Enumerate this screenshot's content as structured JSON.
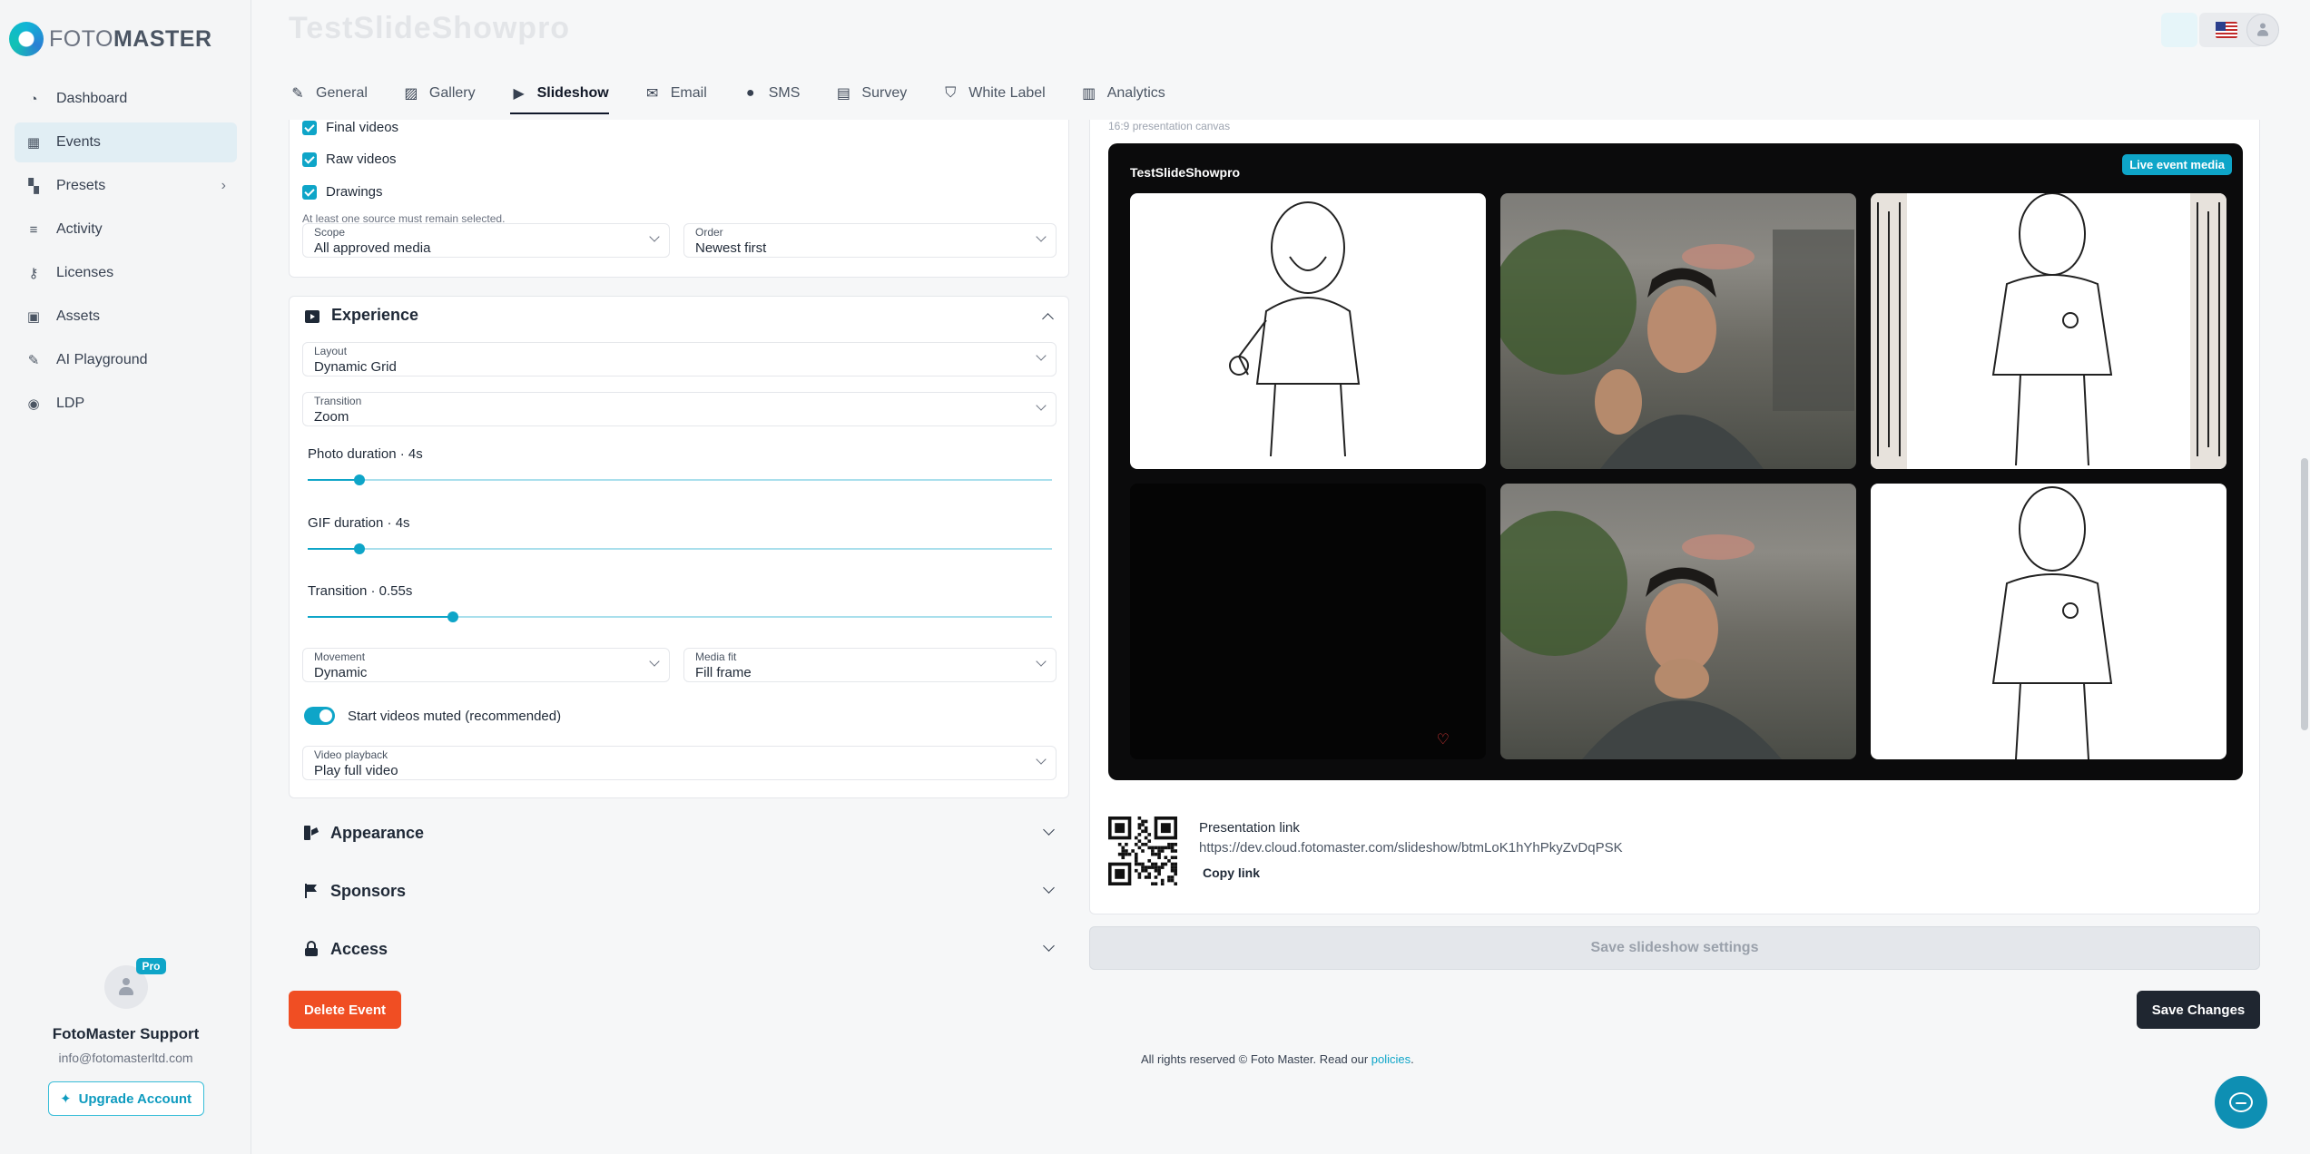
{
  "brand": {
    "name_light": "FOTO",
    "name_bold": "MASTER"
  },
  "page": {
    "title": "TestSlideShowpro"
  },
  "sidebar": {
    "items": [
      {
        "label": "Dashboard",
        "icon": "dashboard-icon",
        "glyph": "◔"
      },
      {
        "label": "Events",
        "icon": "calendar-icon",
        "glyph": "▦"
      },
      {
        "label": "Presets",
        "icon": "presets-icon",
        "glyph": "▚"
      },
      {
        "label": "Activity",
        "icon": "activity-icon",
        "glyph": "≡"
      },
      {
        "label": "Licenses",
        "icon": "key-icon",
        "glyph": "⚷"
      },
      {
        "label": "Assets",
        "icon": "bag-icon",
        "glyph": "▣"
      },
      {
        "label": "AI Playground",
        "icon": "wand-icon",
        "glyph": "✎"
      },
      {
        "label": "LDP",
        "icon": "pin-icon",
        "glyph": "◉"
      }
    ],
    "active_index": 1
  },
  "profile": {
    "badge": "Pro",
    "name": "FotoMaster Support",
    "email": "info@fotomasterltd.com",
    "upgrade_label": "Upgrade Account"
  },
  "tabs": [
    {
      "label": "General",
      "icon": "pencil-icon",
      "glyph": "✎"
    },
    {
      "label": "Gallery",
      "icon": "gallery-icon",
      "glyph": "▨"
    },
    {
      "label": "Slideshow",
      "icon": "slideshow-icon",
      "glyph": "▶"
    },
    {
      "label": "Email",
      "icon": "mail-icon",
      "glyph": "✉"
    },
    {
      "label": "SMS",
      "icon": "chat-icon",
      "glyph": "●"
    },
    {
      "label": "Survey",
      "icon": "clipboard-icon",
      "glyph": "▤"
    },
    {
      "label": "White Label",
      "icon": "shield-icon",
      "glyph": "⛉"
    },
    {
      "label": "Analytics",
      "icon": "chart-icon",
      "glyph": "▥"
    }
  ],
  "sources": {
    "checkboxes": [
      "Final videos",
      "Raw videos",
      "Drawings"
    ],
    "hint": "At least one source must remain selected.",
    "scope": {
      "label": "Scope",
      "value": "All approved media"
    },
    "order": {
      "label": "Order",
      "value": "Newest first"
    }
  },
  "experience": {
    "title": "Experience",
    "layout": {
      "label": "Layout",
      "value": "Dynamic Grid"
    },
    "transition_select": {
      "label": "Transition",
      "value": "Zoom"
    },
    "photo_duration": {
      "label": "Photo duration · 4s",
      "fraction": 0.07
    },
    "gif_duration": {
      "label": "GIF duration · 4s",
      "fraction": 0.07
    },
    "transition_duration": {
      "label": "Transition · 0.55s",
      "fraction": 0.195
    },
    "movement": {
      "label": "Movement",
      "value": "Dynamic"
    },
    "media_fit": {
      "label": "Media fit",
      "value": "Fill frame"
    },
    "mute_toggle": {
      "label": "Start videos muted (recommended)",
      "on": true
    },
    "video_playback": {
      "label": "Video playback",
      "value": "Play full video"
    }
  },
  "sections": {
    "appearance": "Appearance",
    "sponsors": "Sponsors",
    "access": "Access"
  },
  "buttons": {
    "delete": "Delete Event",
    "save_slideshow": "Save slideshow settings",
    "save_changes": "Save Changes"
  },
  "preview": {
    "caption": "16:9 presentation canvas",
    "title": "TestSlideShowpro",
    "badge": "Live event media"
  },
  "presentation": {
    "label": "Presentation link",
    "url": "https://dev.cloud.fotomaster.com/slideshow/btmLoK1hYhPkyZvDqPSK",
    "copy": "Copy link"
  },
  "footer": {
    "text": "All rights reserved © Foto Master. Read our ",
    "link": "policies",
    "end": "."
  },
  "colors": {
    "accent": "#0ea5c8",
    "danger": "#f04e23",
    "dark": "#1f2630"
  }
}
